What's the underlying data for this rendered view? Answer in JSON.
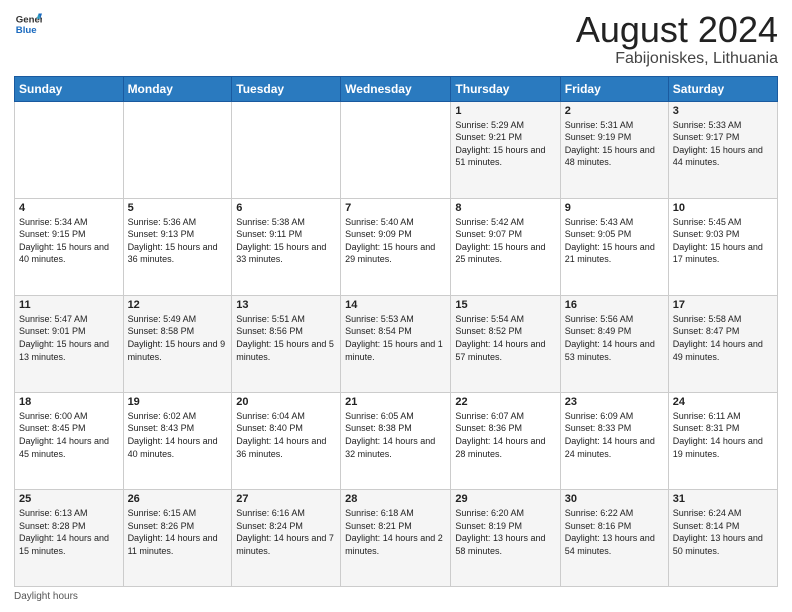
{
  "header": {
    "logo_line1": "General",
    "logo_line2": "Blue",
    "title": "August 2024",
    "subtitle": "Fabijoniskes, Lithuania"
  },
  "days_of_week": [
    "Sunday",
    "Monday",
    "Tuesday",
    "Wednesday",
    "Thursday",
    "Friday",
    "Saturday"
  ],
  "weeks": [
    [
      {
        "day": "",
        "sunrise": "",
        "sunset": "",
        "daylight": ""
      },
      {
        "day": "",
        "sunrise": "",
        "sunset": "",
        "daylight": ""
      },
      {
        "day": "",
        "sunrise": "",
        "sunset": "",
        "daylight": ""
      },
      {
        "day": "",
        "sunrise": "",
        "sunset": "",
        "daylight": ""
      },
      {
        "day": "1",
        "sunrise": "Sunrise: 5:29 AM",
        "sunset": "Sunset: 9:21 PM",
        "daylight": "Daylight: 15 hours and 51 minutes."
      },
      {
        "day": "2",
        "sunrise": "Sunrise: 5:31 AM",
        "sunset": "Sunset: 9:19 PM",
        "daylight": "Daylight: 15 hours and 48 minutes."
      },
      {
        "day": "3",
        "sunrise": "Sunrise: 5:33 AM",
        "sunset": "Sunset: 9:17 PM",
        "daylight": "Daylight: 15 hours and 44 minutes."
      }
    ],
    [
      {
        "day": "4",
        "sunrise": "Sunrise: 5:34 AM",
        "sunset": "Sunset: 9:15 PM",
        "daylight": "Daylight: 15 hours and 40 minutes."
      },
      {
        "day": "5",
        "sunrise": "Sunrise: 5:36 AM",
        "sunset": "Sunset: 9:13 PM",
        "daylight": "Daylight: 15 hours and 36 minutes."
      },
      {
        "day": "6",
        "sunrise": "Sunrise: 5:38 AM",
        "sunset": "Sunset: 9:11 PM",
        "daylight": "Daylight: 15 hours and 33 minutes."
      },
      {
        "day": "7",
        "sunrise": "Sunrise: 5:40 AM",
        "sunset": "Sunset: 9:09 PM",
        "daylight": "Daylight: 15 hours and 29 minutes."
      },
      {
        "day": "8",
        "sunrise": "Sunrise: 5:42 AM",
        "sunset": "Sunset: 9:07 PM",
        "daylight": "Daylight: 15 hours and 25 minutes."
      },
      {
        "day": "9",
        "sunrise": "Sunrise: 5:43 AM",
        "sunset": "Sunset: 9:05 PM",
        "daylight": "Daylight: 15 hours and 21 minutes."
      },
      {
        "day": "10",
        "sunrise": "Sunrise: 5:45 AM",
        "sunset": "Sunset: 9:03 PM",
        "daylight": "Daylight: 15 hours and 17 minutes."
      }
    ],
    [
      {
        "day": "11",
        "sunrise": "Sunrise: 5:47 AM",
        "sunset": "Sunset: 9:01 PM",
        "daylight": "Daylight: 15 hours and 13 minutes."
      },
      {
        "day": "12",
        "sunrise": "Sunrise: 5:49 AM",
        "sunset": "Sunset: 8:58 PM",
        "daylight": "Daylight: 15 hours and 9 minutes."
      },
      {
        "day": "13",
        "sunrise": "Sunrise: 5:51 AM",
        "sunset": "Sunset: 8:56 PM",
        "daylight": "Daylight: 15 hours and 5 minutes."
      },
      {
        "day": "14",
        "sunrise": "Sunrise: 5:53 AM",
        "sunset": "Sunset: 8:54 PM",
        "daylight": "Daylight: 15 hours and 1 minute."
      },
      {
        "day": "15",
        "sunrise": "Sunrise: 5:54 AM",
        "sunset": "Sunset: 8:52 PM",
        "daylight": "Daylight: 14 hours and 57 minutes."
      },
      {
        "day": "16",
        "sunrise": "Sunrise: 5:56 AM",
        "sunset": "Sunset: 8:49 PM",
        "daylight": "Daylight: 14 hours and 53 minutes."
      },
      {
        "day": "17",
        "sunrise": "Sunrise: 5:58 AM",
        "sunset": "Sunset: 8:47 PM",
        "daylight": "Daylight: 14 hours and 49 minutes."
      }
    ],
    [
      {
        "day": "18",
        "sunrise": "Sunrise: 6:00 AM",
        "sunset": "Sunset: 8:45 PM",
        "daylight": "Daylight: 14 hours and 45 minutes."
      },
      {
        "day": "19",
        "sunrise": "Sunrise: 6:02 AM",
        "sunset": "Sunset: 8:43 PM",
        "daylight": "Daylight: 14 hours and 40 minutes."
      },
      {
        "day": "20",
        "sunrise": "Sunrise: 6:04 AM",
        "sunset": "Sunset: 8:40 PM",
        "daylight": "Daylight: 14 hours and 36 minutes."
      },
      {
        "day": "21",
        "sunrise": "Sunrise: 6:05 AM",
        "sunset": "Sunset: 8:38 PM",
        "daylight": "Daylight: 14 hours and 32 minutes."
      },
      {
        "day": "22",
        "sunrise": "Sunrise: 6:07 AM",
        "sunset": "Sunset: 8:36 PM",
        "daylight": "Daylight: 14 hours and 28 minutes."
      },
      {
        "day": "23",
        "sunrise": "Sunrise: 6:09 AM",
        "sunset": "Sunset: 8:33 PM",
        "daylight": "Daylight: 14 hours and 24 minutes."
      },
      {
        "day": "24",
        "sunrise": "Sunrise: 6:11 AM",
        "sunset": "Sunset: 8:31 PM",
        "daylight": "Daylight: 14 hours and 19 minutes."
      }
    ],
    [
      {
        "day": "25",
        "sunrise": "Sunrise: 6:13 AM",
        "sunset": "Sunset: 8:28 PM",
        "daylight": "Daylight: 14 hours and 15 minutes."
      },
      {
        "day": "26",
        "sunrise": "Sunrise: 6:15 AM",
        "sunset": "Sunset: 8:26 PM",
        "daylight": "Daylight: 14 hours and 11 minutes."
      },
      {
        "day": "27",
        "sunrise": "Sunrise: 6:16 AM",
        "sunset": "Sunset: 8:24 PM",
        "daylight": "Daylight: 14 hours and 7 minutes."
      },
      {
        "day": "28",
        "sunrise": "Sunrise: 6:18 AM",
        "sunset": "Sunset: 8:21 PM",
        "daylight": "Daylight: 14 hours and 2 minutes."
      },
      {
        "day": "29",
        "sunrise": "Sunrise: 6:20 AM",
        "sunset": "Sunset: 8:19 PM",
        "daylight": "Daylight: 13 hours and 58 minutes."
      },
      {
        "day": "30",
        "sunrise": "Sunrise: 6:22 AM",
        "sunset": "Sunset: 8:16 PM",
        "daylight": "Daylight: 13 hours and 54 minutes."
      },
      {
        "day": "31",
        "sunrise": "Sunrise: 6:24 AM",
        "sunset": "Sunset: 8:14 PM",
        "daylight": "Daylight: 13 hours and 50 minutes."
      }
    ]
  ],
  "footer": {
    "label": "Daylight hours"
  }
}
